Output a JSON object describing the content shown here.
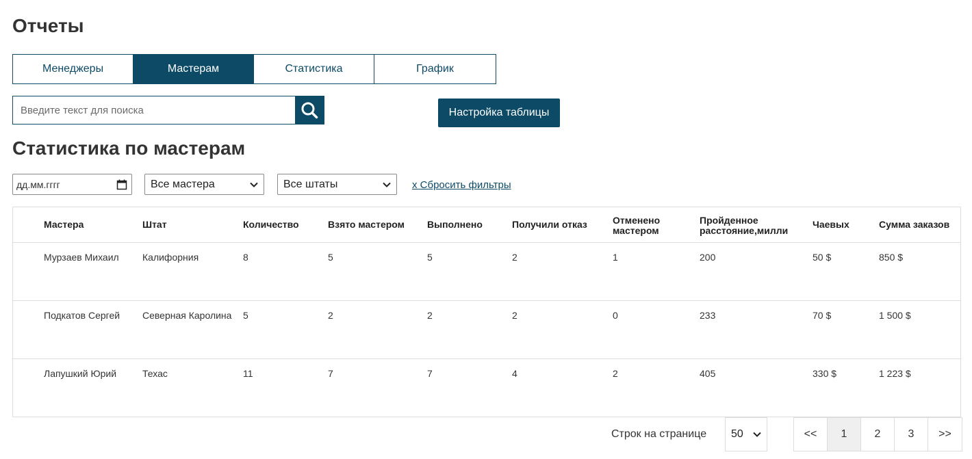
{
  "page": {
    "title": "Отчеты"
  },
  "tabs": [
    {
      "label": "Менеджеры"
    },
    {
      "label": "Мастерам",
      "active": true
    },
    {
      "label": "Статистика"
    },
    {
      "label": "График"
    }
  ],
  "search": {
    "placeholder": "Введите текст для поиска",
    "value": ""
  },
  "settings_button": {
    "label": "Настройка таблицы"
  },
  "section": {
    "title": "Статистика по мастерам"
  },
  "filters": {
    "date_placeholder": "дд.мм.гггг",
    "masters_select": "Все мастера",
    "states_select": "Все штаты",
    "reset_label": "x Сбросить фильтры"
  },
  "table": {
    "headers": [
      [
        "Мастера"
      ],
      [
        "Штат"
      ],
      [
        "Количество"
      ],
      [
        "Взято мастером"
      ],
      [
        "Выполнено"
      ],
      [
        "Получили отказ"
      ],
      [
        "Отменено",
        "мастером"
      ],
      [
        "Пройденное",
        "расстояние,милли"
      ],
      [
        "Чаевых"
      ],
      [
        "Сумма заказов"
      ]
    ],
    "rows": [
      [
        "Мурзаев Михаил",
        "Калифорния",
        "8",
        "5",
        "5",
        "2",
        "1",
        "200",
        "50 $",
        "850 $"
      ],
      [
        "Подкатов Сергей",
        "Северная Каролина",
        "5",
        "2",
        "2",
        "2",
        "0",
        "233",
        "70 $",
        "1 500 $"
      ],
      [
        "Лапушкий Юрий",
        "Техас",
        "11",
        "7",
        "7",
        "4",
        "2",
        "405",
        "330 $",
        "1 223 $"
      ]
    ]
  },
  "pagination": {
    "rows_label": "Строк на странице",
    "rows_per_page": "50",
    "buttons": [
      "<<",
      "1",
      "2",
      "3",
      ">>"
    ],
    "current": "1"
  },
  "colors": {
    "primary": "#0c4a66",
    "border": "#dddddd",
    "text": "#333333"
  },
  "icons": {
    "search": "search-icon",
    "calendar": "calendar-icon",
    "dropdown": "chevron-down-icon"
  }
}
